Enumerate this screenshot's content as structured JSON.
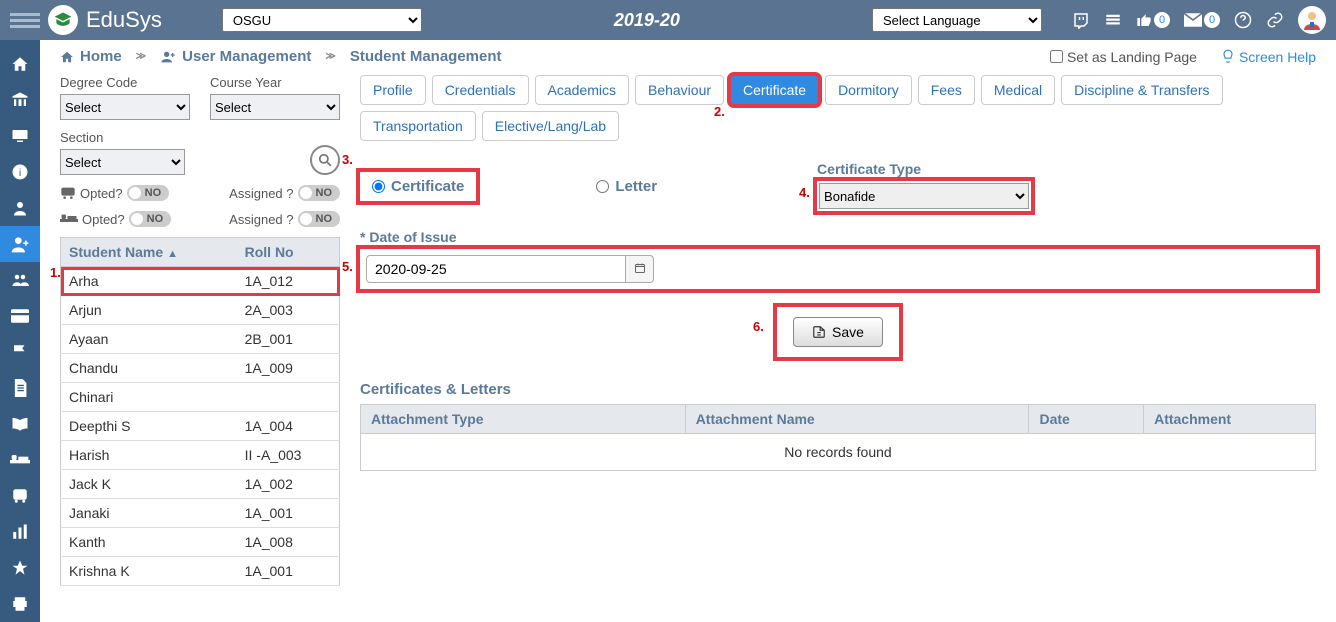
{
  "header": {
    "brand": "EduSys",
    "institution_selected": "OSGU",
    "year_title": "2019-20",
    "lang_selected": "Select Language",
    "badge_thumb": "0",
    "badge_mail": "0"
  },
  "breadcrumb": {
    "home": "Home",
    "user_mgmt": "User Management",
    "student_mgmt": "Student Management",
    "set_landing": "Set as Landing Page",
    "screen_help": "Screen Help"
  },
  "filters": {
    "degree_label": "Degree Code",
    "degree_value": "Select",
    "course_label": "Course Year",
    "course_value": "Select",
    "section_label": "Section",
    "section_value": "Select",
    "bus_opted": "Opted?",
    "bus_assigned": "Assigned ?",
    "bed_opted": "Opted?",
    "bed_assigned": "Assigned ?",
    "toggle_no": "NO"
  },
  "students": {
    "header_name": "Student Name",
    "header_roll": "Roll No",
    "rows": [
      {
        "name": "Arha",
        "roll": "1A_012"
      },
      {
        "name": "Arjun",
        "roll": "2A_003"
      },
      {
        "name": "Ayaan",
        "roll": "2B_001"
      },
      {
        "name": "Chandu",
        "roll": "1A_009"
      },
      {
        "name": "Chinari",
        "roll": ""
      },
      {
        "name": "Deepthi S",
        "roll": "1A_004"
      },
      {
        "name": "Harish",
        "roll": "II -A_003"
      },
      {
        "name": "Jack K",
        "roll": "1A_002"
      },
      {
        "name": "Janaki",
        "roll": "1A_001"
      },
      {
        "name": "Kanth",
        "roll": "1A_008"
      },
      {
        "name": "Krishna K",
        "roll": "1A_001"
      }
    ]
  },
  "tabs": {
    "items": [
      {
        "label": "Profile"
      },
      {
        "label": "Credentials"
      },
      {
        "label": "Academics"
      },
      {
        "label": "Behaviour"
      },
      {
        "label": "Certificate",
        "active": true
      },
      {
        "label": "Dormitory"
      },
      {
        "label": "Fees"
      },
      {
        "label": "Medical"
      },
      {
        "label": "Discipline & Transfers"
      },
      {
        "label": "Transportation"
      },
      {
        "label": "Elective/Lang/Lab"
      }
    ]
  },
  "form": {
    "radio_cert": "Certificate",
    "radio_letter": "Letter",
    "cert_type_label": "Certificate Type",
    "cert_type_value": "Bonafide",
    "date_label": "* Date of Issue",
    "date_value": "2020-09-25",
    "save_label": "Save"
  },
  "list": {
    "title": "Certificates & Letters",
    "col_type": "Attachment Type",
    "col_name": "Attachment Name",
    "col_date": "Date",
    "col_att": "Attachment",
    "empty": "No records found"
  },
  "anno": {
    "a1": "1.",
    "a2": "2.",
    "a3": "3.",
    "a4": "4.",
    "a5": "5.",
    "a6": "6."
  }
}
